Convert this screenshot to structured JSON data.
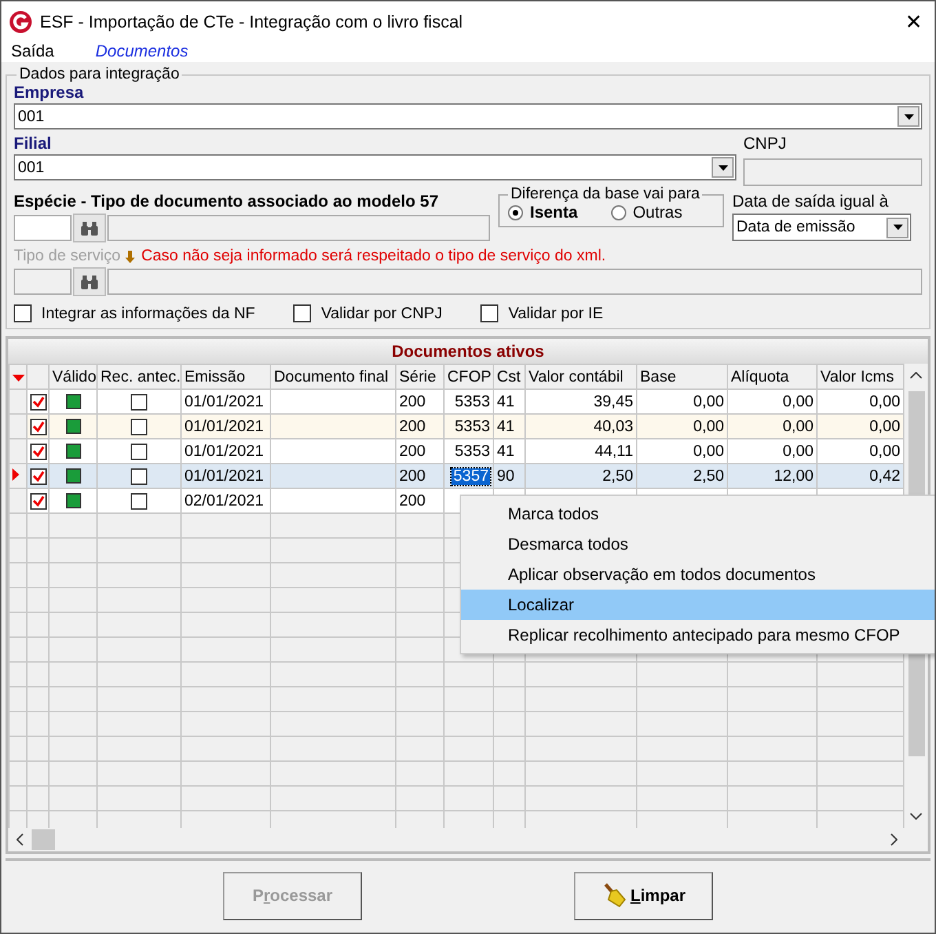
{
  "window": {
    "title": "ESF - Importação de CTe - Integração com o livro fiscal",
    "close": "✕"
  },
  "menu_bar": [
    {
      "label": "Saída",
      "highlighted": false
    },
    {
      "label": "Documentos",
      "highlighted": true
    }
  ],
  "integration": {
    "title": "Dados para integração",
    "empresa": {
      "label": "Empresa",
      "value": "001"
    },
    "filial": {
      "label": "Filial",
      "value": "001"
    },
    "cnpj": {
      "label": "CNPJ"
    },
    "especie": {
      "label": "Espécie - Tipo de documento associado ao modelo 57"
    },
    "diferenca": {
      "title": "Diferença da base vai para",
      "options": [
        {
          "label": "Isenta",
          "selected": true
        },
        {
          "label": "Outras",
          "selected": false
        }
      ]
    },
    "data_saida": {
      "label": "Data de saída igual à",
      "value": "Data de emissão"
    },
    "tipo_servico": {
      "label": "Tipo de serviço",
      "note": "Caso não seja informado será respeitado o tipo de serviço do xml."
    },
    "checkboxes": [
      {
        "label": "Integrar as informações da NF",
        "checked": false
      },
      {
        "label": "Validar por CNPJ",
        "checked": false
      },
      {
        "label": "Validar por IE",
        "checked": false
      }
    ]
  },
  "grid": {
    "title": "Documentos ativos",
    "columns": [
      "Válido",
      "Rec. antec.",
      "Emissão",
      "Documento final",
      "Série",
      "CFOP",
      "Cst",
      "Valor contábil",
      "Base",
      "Alíquota",
      "Valor Icms"
    ],
    "rows": [
      {
        "current": false,
        "tinted": false,
        "checked": true,
        "cells": [
          {
            "kind": "indicator",
            "on": true
          },
          {
            "kind": "checkbox",
            "checked": false
          },
          "01/01/2021",
          "",
          "200",
          "5353",
          "41",
          "39,45",
          "0,00",
          "0,00",
          "0,00"
        ]
      },
      {
        "current": false,
        "tinted": true,
        "checked": true,
        "cells": [
          {
            "kind": "indicator",
            "on": true
          },
          {
            "kind": "checkbox",
            "checked": false
          },
          "01/01/2021",
          "",
          "200",
          "5353",
          "41",
          "40,03",
          "0,00",
          "0,00",
          "0,00"
        ]
      },
      {
        "current": false,
        "tinted": false,
        "checked": true,
        "cells": [
          {
            "kind": "indicator",
            "on": true
          },
          {
            "kind": "checkbox",
            "checked": false
          },
          "01/01/2021",
          "",
          "200",
          "5353",
          "41",
          "44,11",
          "0,00",
          "0,00",
          "0,00"
        ]
      },
      {
        "current": true,
        "tinted": false,
        "checked": true,
        "cells": [
          {
            "kind": "indicator",
            "on": true
          },
          {
            "kind": "checkbox",
            "checked": false
          },
          "01/01/2021",
          "",
          "200",
          {
            "kind": "text",
            "text": "5357",
            "focused": true
          },
          "90",
          "2,50",
          "2,50",
          "12,00",
          "0,42"
        ]
      },
      {
        "current": false,
        "tinted": false,
        "checked": true,
        "cells": [
          {
            "kind": "indicator",
            "on": true
          },
          {
            "kind": "checkbox",
            "checked": false
          },
          "02/01/2021",
          "",
          "200"
        ]
      }
    ]
  },
  "context_menu": [
    {
      "label": "Marca todos",
      "selected": false
    },
    {
      "label": "Desmarca todos",
      "selected": false
    },
    {
      "label": "Aplicar observação em todos documentos",
      "selected": false
    },
    {
      "label": "Localizar",
      "selected": true
    },
    {
      "label": "Replicar recolhimento antecipado para mesmo CFOP",
      "selected": false
    }
  ],
  "buttons": [
    {
      "label_before": "P",
      "mnemonic": "r",
      "label_after": "ocessar",
      "disabled": true,
      "kind": "plain"
    },
    {
      "mnemonic": "L",
      "label_after": "impar",
      "disabled": false,
      "kind": "clear"
    }
  ]
}
